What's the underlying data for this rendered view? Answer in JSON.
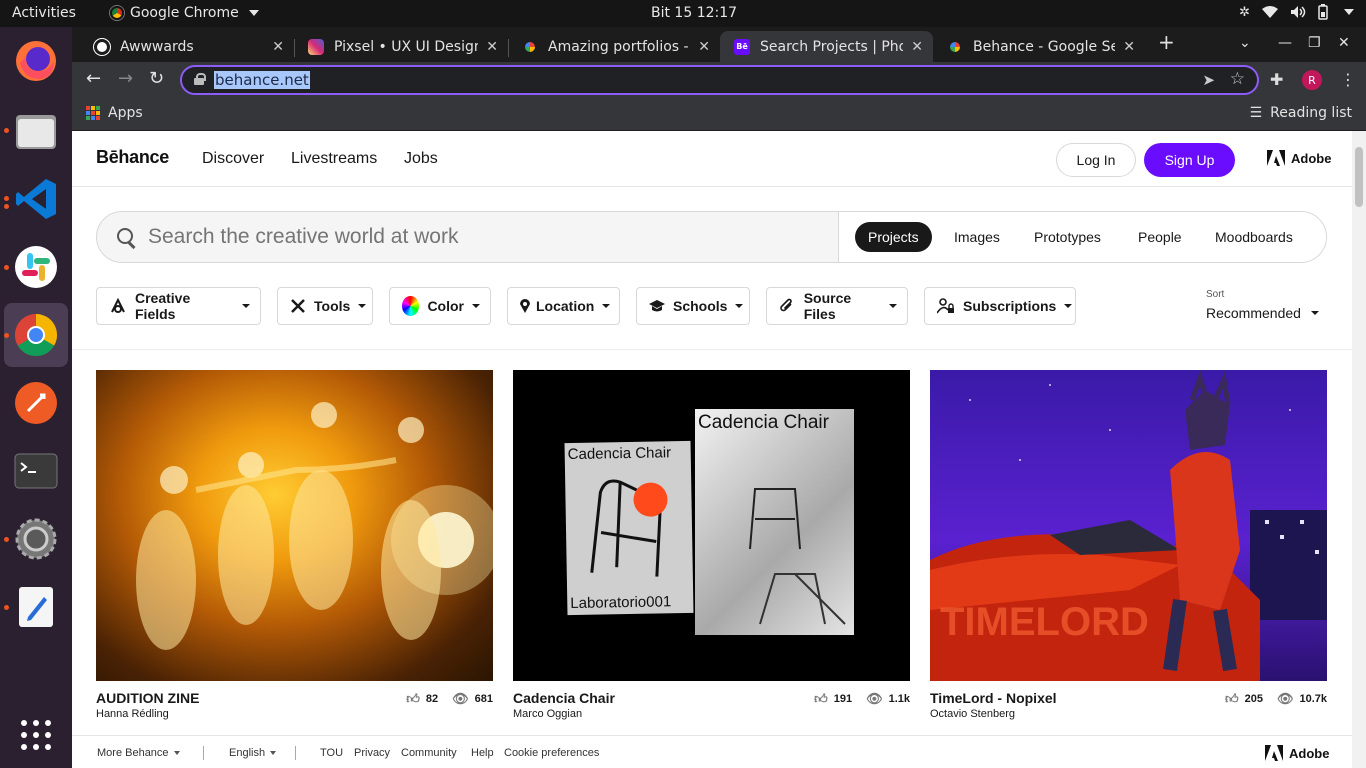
{
  "system": {
    "activities": "Activities",
    "app_name": "Google Chrome",
    "clock": "Bit 15  12:17"
  },
  "dock": {
    "items": [
      "firefox-icon",
      "files-icon",
      "vscode-icon",
      "slack-icon",
      "chrome-icon",
      "postman-icon",
      "terminal-icon",
      "settings-icon",
      "text-editor-icon",
      "app-grid-icon"
    ]
  },
  "browser": {
    "tabs": [
      {
        "title": "Awwwards",
        "favicon_color": "#ffffff"
      },
      {
        "title": "Pixsel • UX UI Design T",
        "favicon_color": "#e1306c"
      },
      {
        "title": "Amazing portfolios - G",
        "favicon_color": "#4285f4"
      },
      {
        "title": "Search Projects | Phot",
        "favicon_color": "#6a0dff"
      },
      {
        "title": "Behance - Google Sear",
        "favicon_color": "#4285f4"
      }
    ],
    "new_tab": "+",
    "url": "behance.net",
    "avatar_letter": "R",
    "bookmarks": {
      "apps": "Apps",
      "reading_list": "Reading list"
    }
  },
  "behance": {
    "logo": "Bēhance",
    "nav": [
      "Discover",
      "Livestreams",
      "Jobs"
    ],
    "login": "Log In",
    "signup": "Sign Up",
    "adobe": "Adobe",
    "search_placeholder": "Search the creative world at work",
    "search_types": [
      "Projects",
      "Images",
      "Prototypes",
      "People",
      "Moodboards"
    ],
    "filters": [
      "Creative Fields",
      "Tools",
      "Color",
      "Location",
      "Schools",
      "Source Files",
      "Subscriptions"
    ],
    "sort_label": "Sort",
    "sort_value": "Recommended",
    "projects": [
      {
        "title": "AUDITION ZINE",
        "owner": "Hanna Rédling",
        "likes": "82",
        "views": "681"
      },
      {
        "title": "Cadencia Chair",
        "owner": "Marco Oggian",
        "likes": "191",
        "views": "1.1k",
        "poster_text_1": "Cadencia Chair",
        "poster_text_2": "Laboratorio001",
        "poster_text_3": "Cadencia Chair"
      },
      {
        "title": "TimeLord - Nopixel",
        "owner": "Octavio Stenberg",
        "likes": "205",
        "views": "10.7k"
      }
    ],
    "footer": {
      "more": "More Behance",
      "language": "English",
      "links": [
        "TOU",
        "Privacy",
        "Community",
        "Help",
        "Cookie preferences"
      ],
      "adobe": "Adobe"
    }
  },
  "colors": {
    "accent": "#6a0dff",
    "omnibox_border": "#8b5cf6"
  }
}
